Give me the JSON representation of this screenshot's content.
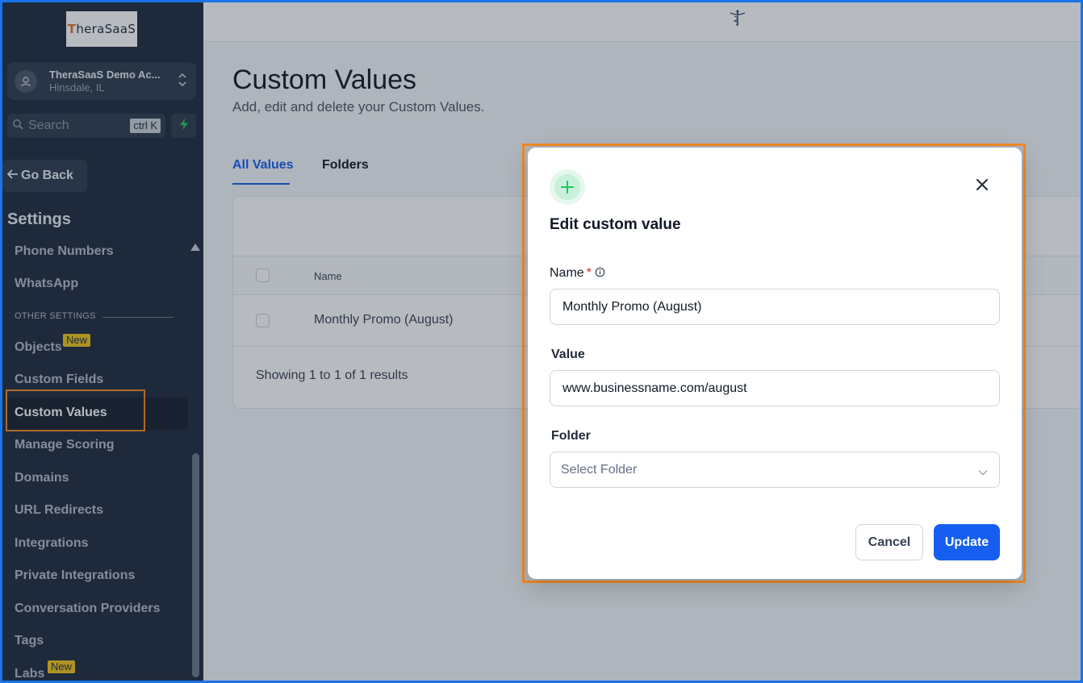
{
  "sidebar": {
    "logo_prefix": "T",
    "logo_rest": "heraSaaS",
    "account": {
      "name": "TheraSaaS Demo Ac...",
      "location": "Hinsdale, IL"
    },
    "search": {
      "placeholder": "Search",
      "shortcut": "ctrl K"
    },
    "go_back": "Go Back",
    "settings_title": "Settings",
    "items": [
      {
        "label": "Phone Numbers"
      },
      {
        "label": "WhatsApp"
      },
      {
        "label": "Objects",
        "badge": "New"
      },
      {
        "label": "Custom Fields"
      },
      {
        "label": "Custom Values",
        "active": true
      },
      {
        "label": "Manage Scoring"
      },
      {
        "label": "Domains"
      },
      {
        "label": "URL Redirects"
      },
      {
        "label": "Integrations"
      },
      {
        "label": "Private Integrations"
      },
      {
        "label": "Conversation Providers"
      },
      {
        "label": "Tags"
      },
      {
        "label": "Labs",
        "badge": "New"
      }
    ],
    "other_settings_label": "OTHER SETTINGS"
  },
  "page": {
    "title": "Custom Values",
    "subtitle": "Add, edit and delete your Custom Values.",
    "tabs": [
      {
        "label": "All Values",
        "active": true
      },
      {
        "label": "Folders"
      }
    ],
    "table": {
      "columns": [
        "Name"
      ],
      "rows": [
        {
          "name": "Monthly Promo (August)"
        }
      ],
      "footer": "Showing 1 to 1 of 1 results"
    }
  },
  "modal": {
    "title": "Edit custom value",
    "name_label": "Name",
    "required_mark": "*",
    "name_value": "Monthly Promo (August)",
    "value_label": "Value",
    "value_value": "www.businessname.com/august",
    "folder_label": "Folder",
    "folder_placeholder": "Select Folder",
    "cancel_label": "Cancel",
    "update_label": "Update"
  },
  "colors": {
    "sidebar_bg": "#1e2a3b",
    "primary": "#155eef",
    "highlight": "#f08a24",
    "frame": "#1a73e8",
    "success_icon": "#22c55e"
  }
}
